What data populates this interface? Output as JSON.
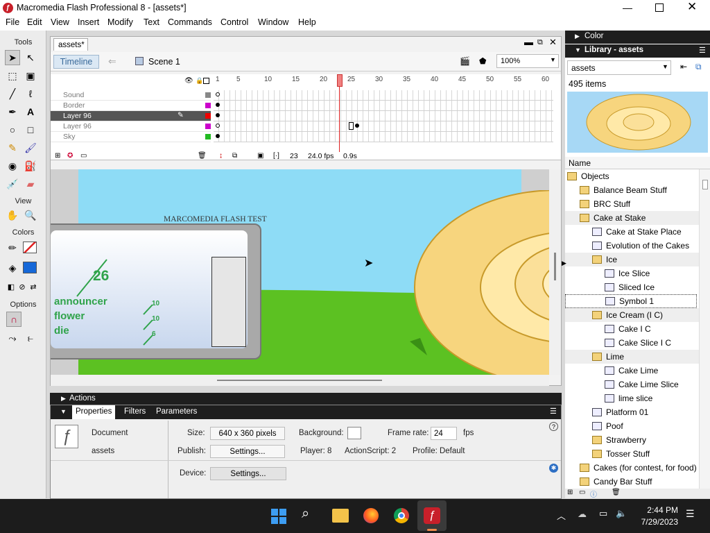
{
  "window": {
    "title": "Macromedia Flash Professional 8 - [assets*]"
  },
  "menu": [
    "File",
    "Edit",
    "View",
    "Insert",
    "Modify",
    "Text",
    "Commands",
    "Control",
    "Window",
    "Help"
  ],
  "tools": {
    "header": "Tools",
    "view_label": "View",
    "colors_label": "Colors",
    "options_label": "Options"
  },
  "document": {
    "tab": "assets*",
    "timeline_button": "Timeline",
    "scene": "Scene 1",
    "zoom": "100%",
    "frame_numbers": [
      "1",
      "5",
      "10",
      "15",
      "20",
      "25",
      "30",
      "35",
      "40",
      "45",
      "50",
      "55",
      "60"
    ],
    "layers": [
      {
        "name": "Sound",
        "selected": false
      },
      {
        "name": "Border",
        "selected": false
      },
      {
        "name": "Layer 96",
        "selected": true
      },
      {
        "name": "Layer 96",
        "selected": false
      },
      {
        "name": "Sky",
        "selected": false
      }
    ],
    "current_frame": "23",
    "fps": "24.0 fps",
    "time": "0.9s"
  },
  "stage": {
    "heading": "MARCOMEDIA FLASH TEST",
    "score": "26",
    "words": [
      "announcer",
      "flower",
      "die"
    ],
    "small_numbers": [
      "10",
      "10",
      "6"
    ]
  },
  "actions_label": "Actions",
  "properties": {
    "tabs": [
      "Properties",
      "Filters",
      "Parameters"
    ],
    "doc_label": "Document",
    "doc_name": "assets",
    "size_label": "Size:",
    "size_value": "640 x 360 pixels",
    "background_label": "Background:",
    "framerate_label": "Frame rate:",
    "framerate_value": "24",
    "fps_unit": "fps",
    "publish_label": "Publish:",
    "settings_label": "Settings...",
    "player_label": "Player: 8",
    "actionscript_label": "ActionScript: 2",
    "profile_label": "Profile: Default",
    "device_label": "Device:",
    "device_settings": "Settings..."
  },
  "panels": {
    "color_title": "Color",
    "library_title": "Library - assets",
    "library_select": "assets",
    "item_count": "495 items",
    "name_header": "Name"
  },
  "library_items": [
    {
      "name": "Objects",
      "type": "folder-open",
      "level": 0
    },
    {
      "name": "Balance Beam Stuff",
      "type": "folder",
      "level": 1
    },
    {
      "name": "BRC Stuff",
      "type": "folder",
      "level": 1
    },
    {
      "name": "Cake at Stake",
      "type": "folder-open",
      "level": 1
    },
    {
      "name": "Cake at Stake Place",
      "type": "symbol",
      "level": 2
    },
    {
      "name": "Evolution of the Cakes",
      "type": "symbol",
      "level": 2
    },
    {
      "name": "Ice",
      "type": "folder-open",
      "level": 2
    },
    {
      "name": "Ice Slice",
      "type": "symbol",
      "level": 3
    },
    {
      "name": "Sliced Ice",
      "type": "symbol",
      "level": 3
    },
    {
      "name": "Symbol 1",
      "type": "symbol",
      "level": 3
    },
    {
      "name": "Ice Cream (I C)",
      "type": "folder-open",
      "level": 2
    },
    {
      "name": "Cake I C",
      "type": "symbol",
      "level": 3
    },
    {
      "name": "Cake Slice I C",
      "type": "symbol",
      "level": 3
    },
    {
      "name": "Lime",
      "type": "folder-open",
      "level": 2
    },
    {
      "name": "Cake Lime",
      "type": "symbol",
      "level": 3
    },
    {
      "name": "Cake Lime Slice",
      "type": "symbol",
      "level": 3
    },
    {
      "name": "lime slice",
      "type": "symbol",
      "level": 3
    },
    {
      "name": "Platform 01",
      "type": "symbol",
      "level": 2
    },
    {
      "name": "Poof",
      "type": "symbol",
      "level": 2
    },
    {
      "name": "Strawberry",
      "type": "folder",
      "level": 2
    },
    {
      "name": "Tosser Stuff",
      "type": "folder",
      "level": 2
    },
    {
      "name": "Cakes (for contest, for food)",
      "type": "folder",
      "level": 1
    },
    {
      "name": "Candy Bar Stuff",
      "type": "folder",
      "level": 1
    }
  ],
  "clock": {
    "time": "2:44 PM",
    "date": "7/29/2023"
  }
}
